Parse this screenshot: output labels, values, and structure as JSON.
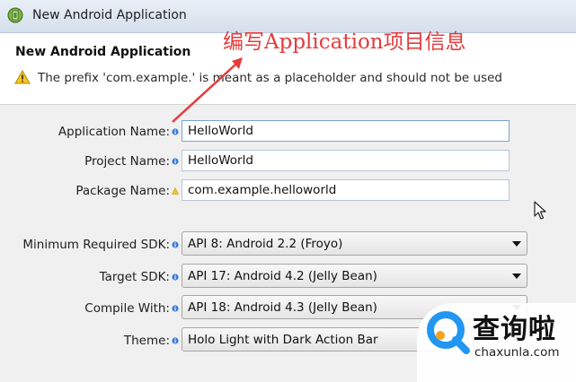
{
  "window": {
    "title": "New Android Application",
    "app_icon": "android-app-icon"
  },
  "header": {
    "title": "New Android Application",
    "message_icon": "warning-icon",
    "message": "The prefix 'com.example.' is meant as a placeholder and should not be used"
  },
  "form": {
    "app_name": {
      "label": "Application Name:",
      "value": "HelloWorld",
      "deco": "info-icon"
    },
    "project_name": {
      "label": "Project Name:",
      "value": "HelloWorld",
      "deco": "info-icon"
    },
    "package_name": {
      "label": "Package Name:",
      "value": "com.example.helloworld",
      "deco": "warning-icon"
    },
    "min_sdk": {
      "label": "Minimum Required SDK:",
      "value": "API 8: Android 2.2 (Froyo)",
      "deco": "info-icon"
    },
    "target_sdk": {
      "label": "Target SDK:",
      "value": "API 17: Android 4.2 (Jelly Bean)",
      "deco": "info-icon"
    },
    "compile_with": {
      "label": "Compile With:",
      "value": "API 18: Android 4.3 (Jelly Bean)",
      "deco": "info-icon"
    },
    "theme": {
      "label": "Theme:",
      "value": "Holo Light with Dark Action Bar",
      "deco": "info-icon"
    }
  },
  "annotation": {
    "text": "编写Application项目信息",
    "color": "#e53a3a"
  },
  "watermark": {
    "brand": "查询啦",
    "domain": "chaxunla.com",
    "logo_color": "#2196f3",
    "logo_accent": "#f6a21e"
  },
  "colors": {
    "titlebar": "#d5dfec",
    "body": "#f0f0f0",
    "info_blue": "#3a7bd5",
    "warning_yellow": "#f3c623"
  }
}
